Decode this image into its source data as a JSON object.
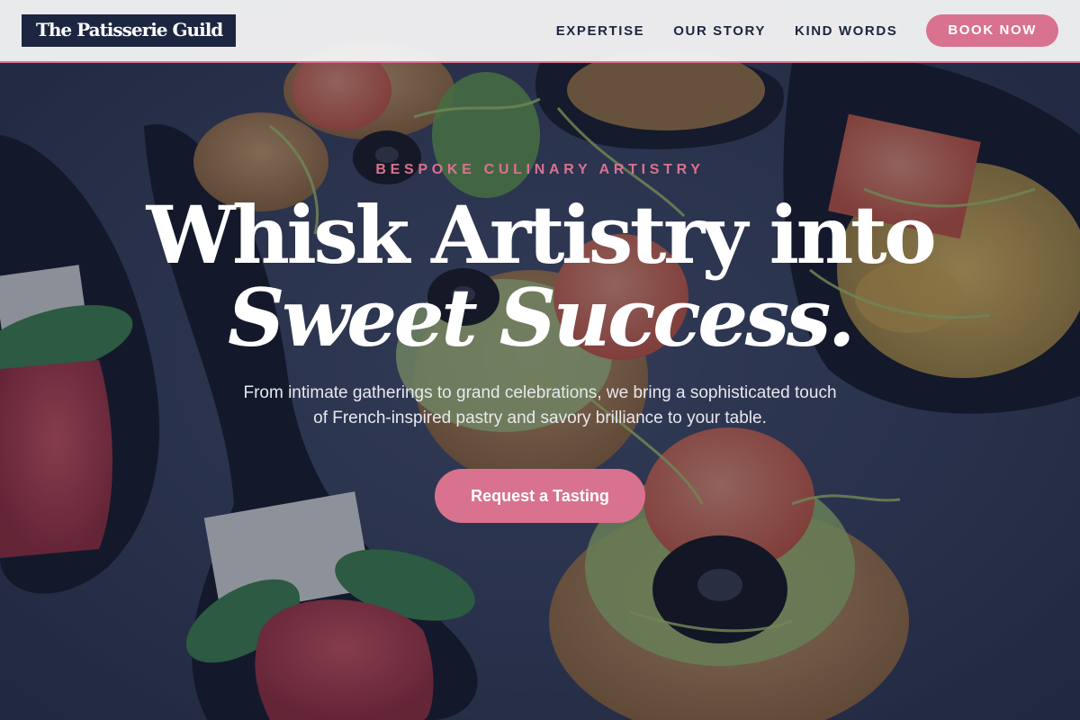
{
  "brand": {
    "name": "The Patisserie Guild",
    "accent": "#d9728f",
    "navy": "#1d2640"
  },
  "nav": {
    "links": [
      "EXPERTISE",
      "OUR STORY",
      "KIND WORDS"
    ],
    "cta_label": "BOOK NOW"
  },
  "hero": {
    "eyebrow": "BESPOKE CULINARY ARTISTRY",
    "headline_line1": "Whisk Artistry into",
    "headline_line2": "Sweet Success.",
    "subtext": "From intimate gatherings to grand celebrations, we bring a sophisticated touch of French-inspired pastry and savory brilliance to your table.",
    "cta_label": "Request a Tasting",
    "background_image": "canapés-on-slate-photo"
  }
}
